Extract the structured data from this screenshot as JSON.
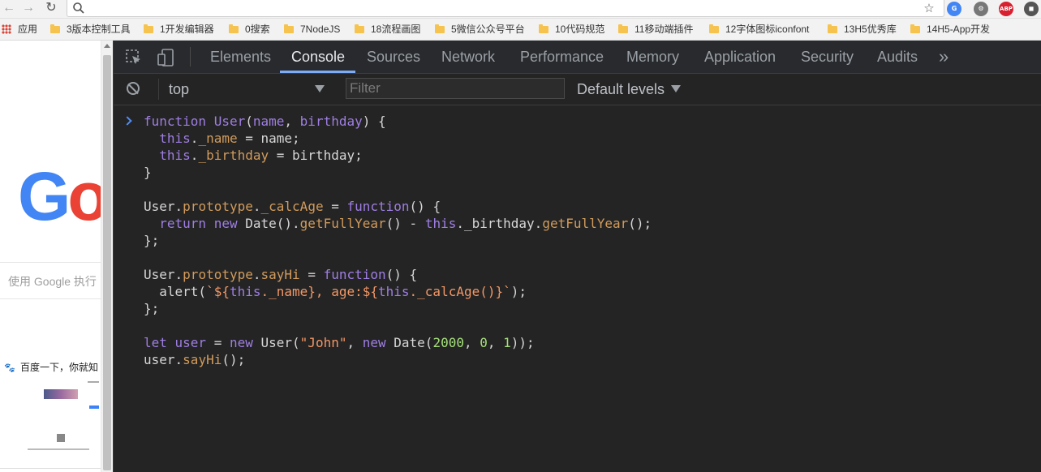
{
  "browser": {
    "nav": {
      "back": "←",
      "forward": "→",
      "reload": "↻"
    },
    "omnibox": {
      "value": "",
      "placeholder": ""
    },
    "star_icon": "☆",
    "extensions": [
      {
        "name": "translate-icon",
        "label": "G",
        "color": "#4285f4"
      },
      {
        "name": "settings-extension-icon",
        "label": "⚙",
        "color": "#777777"
      },
      {
        "name": "abp-icon",
        "label": "ABP",
        "color": "#d8202f"
      },
      {
        "name": "extension-icon",
        "label": "◼",
        "color": "#555555"
      }
    ]
  },
  "bookmarks": [
    {
      "label": "应用",
      "type": "apps"
    },
    {
      "label": "3版本控制工具",
      "type": "folder"
    },
    {
      "label": "1开发编辑器",
      "type": "folder"
    },
    {
      "label": "0搜索",
      "type": "folder"
    },
    {
      "label": "7NodeJS",
      "type": "folder"
    },
    {
      "label": "18流程画图",
      "type": "folder"
    },
    {
      "label": "5微信公众号平台",
      "type": "folder"
    },
    {
      "label": "10代码规范",
      "type": "folder"
    },
    {
      "label": "11移动端插件",
      "type": "folder"
    },
    {
      "label": "12字体图标iconfont",
      "type": "folder"
    },
    {
      "label": "13H5优秀库",
      "type": "folder"
    },
    {
      "label": "14H5-App开发",
      "type": "folder"
    }
  ],
  "page": {
    "logo_letters": [
      "G",
      "o"
    ],
    "search_hint": "使用 Google 执行",
    "baidu_text": "百度一下，你就知"
  },
  "devtools": {
    "tabs": [
      {
        "label": "Elements",
        "active": false
      },
      {
        "label": "Console",
        "active": true
      },
      {
        "label": "Sources",
        "active": false
      },
      {
        "label": "Network",
        "active": false
      },
      {
        "label": "Performance",
        "active": false
      },
      {
        "label": "Memory",
        "active": false
      },
      {
        "label": "Application",
        "active": false
      },
      {
        "label": "Security",
        "active": false
      },
      {
        "label": "Audits",
        "active": false
      }
    ],
    "more_tabs_icon": "»",
    "context": "top",
    "filter_placeholder": "Filter",
    "levels_label": "Default levels",
    "accent": "#7cacf8"
  },
  "console": {
    "lines": [
      [
        [
          "kw",
          "function "
        ],
        [
          "fn",
          "User"
        ],
        [
          "ident",
          "("
        ],
        [
          "prm",
          "name"
        ],
        [
          "ident",
          ", "
        ],
        [
          "prm",
          "birthday"
        ],
        [
          "ident",
          ") {"
        ]
      ],
      [
        [
          "ident",
          "  "
        ],
        [
          "kw",
          "this"
        ],
        [
          "ident",
          "."
        ],
        [
          "prop",
          "_name"
        ],
        [
          "ident",
          " = name;"
        ]
      ],
      [
        [
          "ident",
          "  "
        ],
        [
          "kw",
          "this"
        ],
        [
          "ident",
          "."
        ],
        [
          "prop",
          "_birthday"
        ],
        [
          "ident",
          " = birthday;"
        ]
      ],
      [
        [
          "ident",
          "}"
        ]
      ],
      [
        [
          "ident",
          ""
        ]
      ],
      [
        [
          "ident",
          "User."
        ],
        [
          "prop",
          "prototype"
        ],
        [
          "ident",
          "."
        ],
        [
          "prop",
          "_calcAge"
        ],
        [
          "ident",
          " = "
        ],
        [
          "kw",
          "function"
        ],
        [
          "ident",
          "() {"
        ]
      ],
      [
        [
          "ident",
          "  "
        ],
        [
          "kw",
          "return new "
        ],
        [
          "ident",
          "Date()."
        ],
        [
          "prop",
          "getFullYear"
        ],
        [
          "ident",
          "() - "
        ],
        [
          "kw",
          "this"
        ],
        [
          "ident",
          "._birthday."
        ],
        [
          "prop",
          "getFullYear"
        ],
        [
          "ident",
          "();"
        ]
      ],
      [
        [
          "ident",
          "};"
        ]
      ],
      [
        [
          "ident",
          ""
        ]
      ],
      [
        [
          "ident",
          "User."
        ],
        [
          "prop",
          "prototype"
        ],
        [
          "ident",
          "."
        ],
        [
          "prop",
          "sayHi"
        ],
        [
          "ident",
          " = "
        ],
        [
          "kw",
          "function"
        ],
        [
          "ident",
          "() {"
        ]
      ],
      [
        [
          "ident",
          "  alert("
        ],
        [
          "tpl",
          "`${"
        ],
        [
          "kw",
          "this"
        ],
        [
          "tpl",
          "._name"
        ],
        [
          "tpl",
          "}, age:${"
        ],
        [
          "kw",
          "this"
        ],
        [
          "tpl",
          "._calcAge()"
        ],
        [
          "tpl",
          "}`"
        ],
        [
          "ident",
          ");"
        ]
      ],
      [
        [
          "ident",
          "};"
        ]
      ],
      [
        [
          "ident",
          ""
        ]
      ],
      [
        [
          "kw",
          "let "
        ],
        [
          "prm",
          "user"
        ],
        [
          "ident",
          " = "
        ],
        [
          "kw",
          "new "
        ],
        [
          "ident",
          "User("
        ],
        [
          "str",
          "\"John\""
        ],
        [
          "ident",
          ", "
        ],
        [
          "kw",
          "new "
        ],
        [
          "ident",
          "Date("
        ],
        [
          "num",
          "2000"
        ],
        [
          "ident",
          ", "
        ],
        [
          "num",
          "0"
        ],
        [
          "ident",
          ", "
        ],
        [
          "num",
          "1"
        ],
        [
          "ident",
          "));"
        ]
      ],
      [
        [
          "ident",
          "user."
        ],
        [
          "prop",
          "sayHi"
        ],
        [
          "ident",
          "();"
        ]
      ]
    ]
  }
}
